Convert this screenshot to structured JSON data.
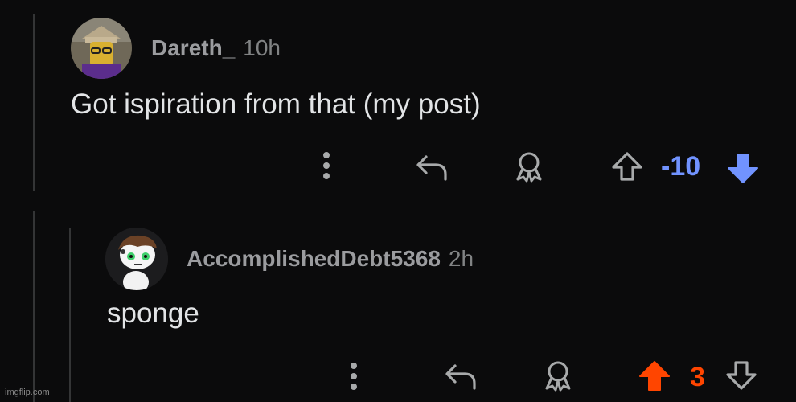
{
  "comments": [
    {
      "username": "Dareth_",
      "time": "10h",
      "body": "Got ispiration from that (my post)",
      "score": "-10",
      "vote_state": "downvoted",
      "score_color": "#7193ff"
    },
    {
      "username": "AccomplishedDebt5368",
      "time": "2h",
      "body": "sponge",
      "score": "3",
      "vote_state": "upvoted",
      "score_color": "#ff4500"
    }
  ],
  "icons": {
    "more": "more-vertical-icon",
    "reply": "reply-arrow-icon",
    "award": "award-icon",
    "upvote": "upvote-arrow-icon",
    "downvote": "downvote-arrow-icon"
  },
  "colors": {
    "background": "#0b0b0c",
    "thread_line": "#343536",
    "icon_gray": "#a8aaab",
    "upvote_orange": "#ff4500",
    "downvote_blue": "#7193ff"
  },
  "watermark": "imgflip.com"
}
